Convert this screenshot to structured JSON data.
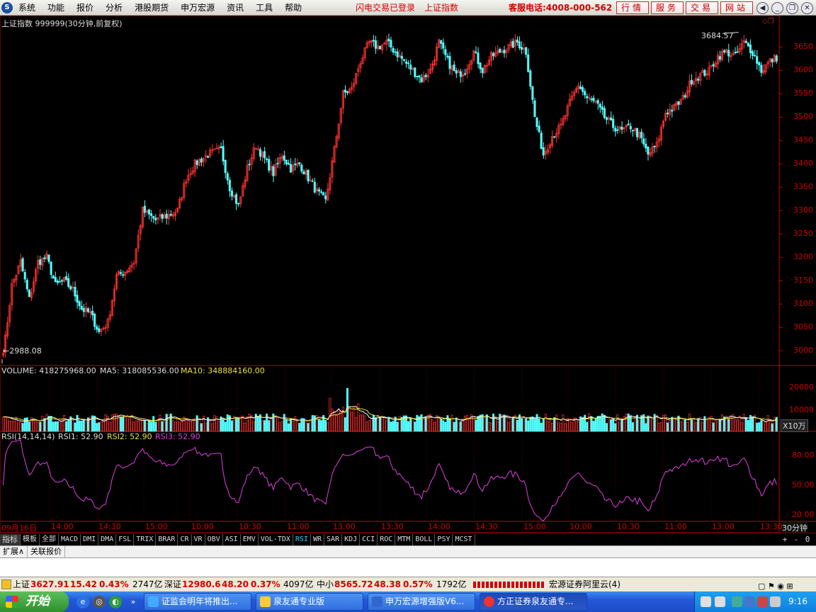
{
  "menu": {
    "logo": "S",
    "items": [
      "系统",
      "功能",
      "报价",
      "分析",
      "港股期货",
      "申万宏源",
      "资讯",
      "工具",
      "帮助"
    ],
    "status1": "闪电交易已登录",
    "status2": "上证指数",
    "hotline": "客服电话:4008-000-562",
    "service_btns": [
      "行情",
      "服务",
      "交易",
      "网站"
    ]
  },
  "price_panel": {
    "title": "上证指数 999999(30分钟,前复权)",
    "max_label": "3684.57",
    "min_label": "←2988.08",
    "y_ticks": [
      "3650",
      "3600",
      "3550",
      "3500",
      "3450",
      "3400",
      "3350",
      "3300",
      "3250",
      "3200",
      "3150",
      "3100",
      "3050",
      "3000"
    ]
  },
  "volume_panel": {
    "label": "VOLUME: 418275968.00",
    "ma5": "MA5: 318085536.00",
    "ma10": "MA10: 348884160.00",
    "y_ticks": [
      "20000",
      "10000"
    ],
    "unit": "X10万"
  },
  "rsi_panel": {
    "label": "RSI(14,14,14)",
    "rsi1": "RSI1: 52.90",
    "rsi2": "RSI2: 52.90",
    "rsi3": "RSI3: 52.90",
    "y_ticks": [
      "80.00",
      "50.00",
      "20.00"
    ]
  },
  "x_axis": {
    "labels": [
      "09月16日",
      "14:00",
      "14:30",
      "15:00",
      "10:00",
      "10:30",
      "11:00",
      "13:00",
      "13:30",
      "14:00",
      "14:30",
      "15:00",
      "10:00",
      "10:30",
      "11:00",
      "13:00",
      "13:30"
    ],
    "period": "30分钟"
  },
  "toolbar": {
    "items": [
      "指标",
      "模板",
      "全部",
      "MACD",
      "DMI",
      "DMA",
      "FSL",
      "TRIX",
      "BRAR",
      "CR",
      "VR",
      "OBV",
      "ASI",
      "EMV",
      "VOL-TDX",
      "RSI",
      "WR",
      "SAR",
      "KDJ",
      "CCI",
      "ROC",
      "MTM",
      "BOLL",
      "PSY",
      "MCST"
    ],
    "active": "RSI",
    "right": [
      "+",
      "-",
      "0"
    ]
  },
  "tabs": [
    "扩展∧",
    "关联报价"
  ],
  "status": {
    "sh_name": "上证",
    "sh_val": "3627.91",
    "sh_chg": "15.42",
    "sh_pct": "0.43%",
    "sh_amt": "2747亿",
    "sz_name": "深证",
    "sz_val": "12980.6",
    "sz_chg": "48.20",
    "sz_pct": "0.37%",
    "sz_amt": "4097亿",
    "zx_name": "中小",
    "zx_val": "8565.72",
    "zx_chg": "48.38",
    "zx_pct": "0.57%",
    "zx_amt": "1792亿",
    "cloud": "宏源证券阿里云(4)"
  },
  "taskbar": {
    "start": "开始",
    "tasks": [
      "证监会明年将推出...",
      "泉友通专业版",
      "申万宏源增强版V6...",
      "方正证券泉友通专..."
    ],
    "clock": "9:16"
  },
  "chart_data": {
    "type": "candlestick",
    "title": "上证指数 999999(30分钟,前复权)",
    "y_range": [
      2970,
      3690
    ],
    "anchors": [
      [
        0,
        2988
      ],
      [
        4,
        3140
      ],
      [
        8,
        3190
      ],
      [
        12,
        3110
      ],
      [
        16,
        3190
      ],
      [
        20,
        3200
      ],
      [
        24,
        3140
      ],
      [
        28,
        3150
      ],
      [
        32,
        3130
      ],
      [
        36,
        3090
      ],
      [
        40,
        3080
      ],
      [
        44,
        3040
      ],
      [
        48,
        3060
      ],
      [
        52,
        3160
      ],
      [
        56,
        3170
      ],
      [
        60,
        3190
      ],
      [
        64,
        3300
      ],
      [
        70,
        3280
      ],
      [
        76,
        3290
      ],
      [
        80,
        3300
      ],
      [
        84,
        3370
      ],
      [
        88,
        3400
      ],
      [
        94,
        3420
      ],
      [
        100,
        3430
      ],
      [
        104,
        3350
      ],
      [
        108,
        3310
      ],
      [
        112,
        3390
      ],
      [
        116,
        3440
      ],
      [
        120,
        3410
      ],
      [
        124,
        3380
      ],
      [
        128,
        3420
      ],
      [
        132,
        3390
      ],
      [
        136,
        3400
      ],
      [
        140,
        3370
      ],
      [
        144,
        3340
      ],
      [
        148,
        3320
      ],
      [
        152,
        3430
      ],
      [
        156,
        3550
      ],
      [
        160,
        3560
      ],
      [
        164,
        3620
      ],
      [
        168,
        3660
      ],
      [
        172,
        3650
      ],
      [
        176,
        3660
      ],
      [
        180,
        3640
      ],
      [
        184,
        3620
      ],
      [
        188,
        3600
      ],
      [
        192,
        3580
      ],
      [
        196,
        3600
      ],
      [
        200,
        3660
      ],
      [
        204,
        3620
      ],
      [
        208,
        3590
      ],
      [
        212,
        3600
      ],
      [
        216,
        3640
      ],
      [
        220,
        3600
      ],
      [
        224,
        3630
      ],
      [
        228,
        3640
      ],
      [
        232,
        3650
      ],
      [
        236,
        3660
      ],
      [
        240,
        3640
      ],
      [
        244,
        3500
      ],
      [
        248,
        3420
      ],
      [
        252,
        3460
      ],
      [
        256,
        3480
      ],
      [
        260,
        3530
      ],
      [
        264,
        3570
      ],
      [
        268,
        3540
      ],
      [
        272,
        3530
      ],
      [
        276,
        3500
      ],
      [
        280,
        3480
      ],
      [
        284,
        3470
      ],
      [
        288,
        3480
      ],
      [
        292,
        3460
      ],
      [
        296,
        3420
      ],
      [
        300,
        3440
      ],
      [
        304,
        3510
      ],
      [
        308,
        3520
      ],
      [
        312,
        3540
      ],
      [
        316,
        3580
      ],
      [
        320,
        3590
      ],
      [
        324,
        3600
      ],
      [
        328,
        3630
      ],
      [
        332,
        3640
      ],
      [
        336,
        3630
      ],
      [
        340,
        3660
      ],
      [
        344,
        3640
      ],
      [
        348,
        3600
      ],
      [
        352,
        3620
      ],
      [
        355,
        3628
      ]
    ],
    "count": 356,
    "max_point": {
      "index": 338,
      "value": 3684.57
    },
    "min_point": {
      "index": 0,
      "value": 2988.08
    },
    "volume_y_range": [
      0,
      25000
    ],
    "rsi_y_range": [
      15,
      95
    ]
  }
}
